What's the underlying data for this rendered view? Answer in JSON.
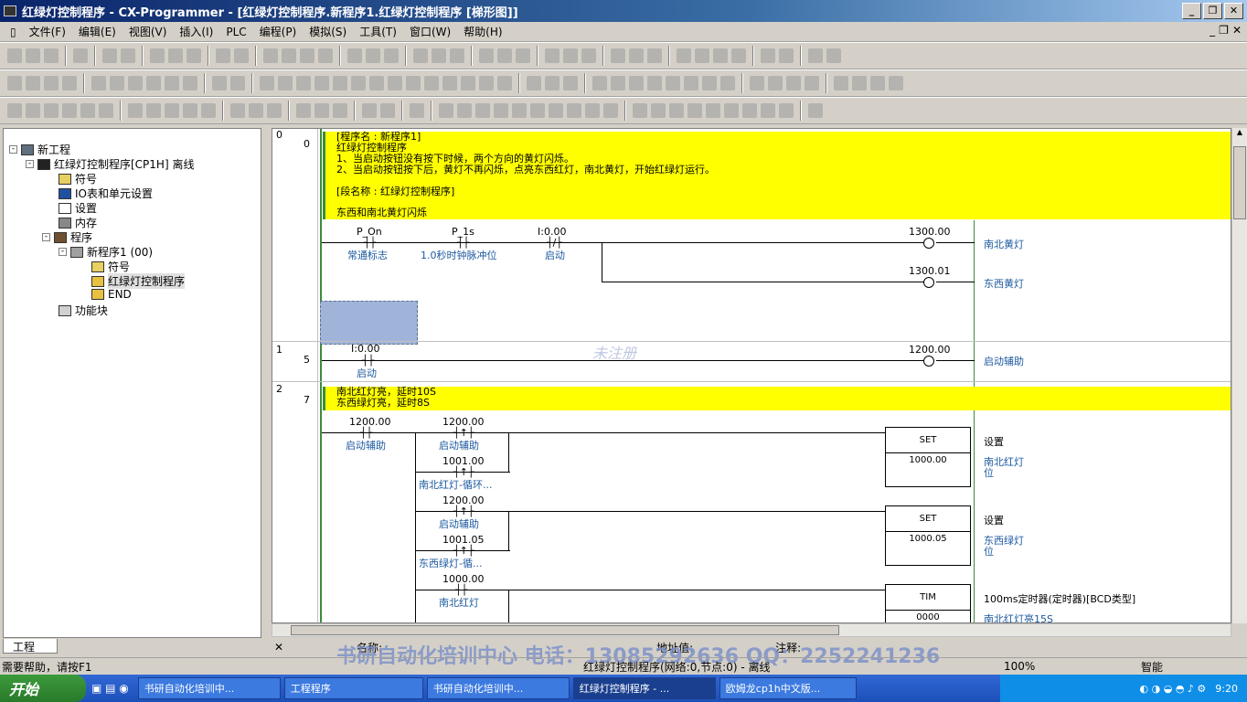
{
  "window": {
    "title": "红绿灯控制程序 - CX-Programmer - [红绿灯控制程序.新程序1.红绿灯控制程序 [梯形图]]"
  },
  "menu": [
    "文件(F)",
    "编辑(E)",
    "视图(V)",
    "插入(I)",
    "PLC",
    "编程(P)",
    "模拟(S)",
    "工具(T)",
    "窗口(W)",
    "帮助(H)"
  ],
  "tree": {
    "root": "新工程",
    "plc": "红绿灯控制程序[CP1H] 离线",
    "symbols": "符号",
    "io": "IO表和单元设置",
    "settings": "设置",
    "memory": "内存",
    "programs": "程序",
    "newprog": "新程序1 (00)",
    "psym": "符号",
    "section": "红绿灯控制程序",
    "end": "END",
    "fb": "功能块",
    "tab": "工程"
  },
  "ladder": {
    "r0": {
      "rung": "0",
      "step": "0",
      "c1": "[程序名 : 新程序1]",
      "c2": "红绿灯控制程序",
      "c3": "1、当启动按钮没有按下时候，两个方向的黄灯闪烁。",
      "c4": "2、当启动按钮按下后，黄灯不再闪烁，点亮东西红灯，南北黄灯，开始红绿灯运行。",
      "c5": "[段名称 : 红绿灯控制程序]",
      "c6": "东西和南北黄灯闪烁",
      "a1": "P_On",
      "a1c": "常通标志",
      "a2": "P_1s",
      "a2c": "1.0秒时钟脉冲位",
      "a3": "I:0.00",
      "a3c": "启动",
      "o1": "1300.00",
      "o1c": "南北黄灯",
      "o2": "1300.01",
      "o2c": "东西黄灯"
    },
    "r1": {
      "rung": "1",
      "step": "5",
      "a": "I:0.00",
      "ac": "启动",
      "o": "1200.00",
      "oc": "启动辅助"
    },
    "r2": {
      "rung": "2",
      "step": "7",
      "c1": "南北红灯亮，延时10S",
      "c2": "东西绿灯亮，延时8S",
      "a": "1200.00",
      "ac": "启动辅助",
      "b1": "1200.00",
      "b1c": "启动辅助",
      "b2": "1001.00",
      "b2c": "南北红灯-循环...",
      "s1": "SET",
      "s1v": "1000.00",
      "s1n": "设置",
      "s1c": "南北红灯",
      "s1c2": "位",
      "b3": "1200.00",
      "b3c": "启动辅助",
      "b4": "1001.05",
      "b4c": "东西绿灯-循...",
      "s2": "SET",
      "s2v": "1000.05",
      "s2n": "设置",
      "s2c": "东西绿灯",
      "s2c2": "位",
      "b5": "1000.00",
      "b5c": "南北红灯",
      "t": "TIM",
      "tv": "0000",
      "tn": "100ms定时器(定时器)[BCD类型]",
      "tc": "南北红灯亮15S"
    }
  },
  "bottom": {
    "name": "名称:",
    "addr": "地址值:",
    "comment": "注释:",
    "overlay": "书研自动化培训中心  电话：13085292636  QQ：2252241236"
  },
  "status": {
    "help": "需要帮助，请按F1",
    "info": "红绿灯控制程序(网络:0,节点:0) - 离线",
    "zoom": "100%",
    "mode": "智能"
  },
  "taskbar": {
    "start": "开始",
    "tasks": [
      "书研自动化培训中...",
      "工程程序",
      "书研自动化培训中...",
      "红绿灯控制程序 - ...",
      "欧姆龙cp1h中文版..."
    ],
    "time": "9:20"
  }
}
